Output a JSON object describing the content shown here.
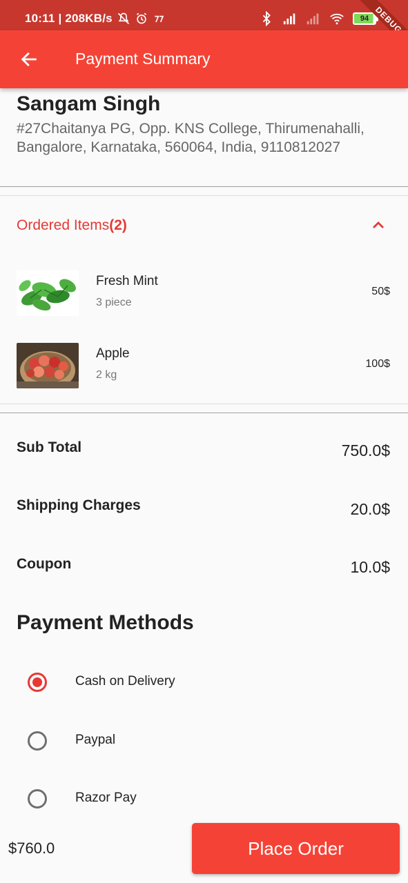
{
  "status_bar": {
    "time_speed": "10:11 | 208KB/s",
    "battery": "94",
    "debug_banner": "DEBUG"
  },
  "app_bar": {
    "title": "Payment Summary"
  },
  "address": {
    "name": "Sangam Singh",
    "text": "#27Chaitanya PG, Opp. KNS College, Thirumenahalli, Bangalore, Karnataka, 560064, India, 9110812027"
  },
  "ordered_items": {
    "label": "Ordered Items",
    "count": "(2)",
    "items": [
      {
        "name": "Fresh Mint",
        "qty": "3 piece",
        "price": "50$"
      },
      {
        "name": "Apple",
        "qty": "2 kg",
        "price": "100$"
      }
    ]
  },
  "totals": {
    "subtotal_label": "Sub Total",
    "subtotal_value": "750.0$",
    "shipping_label": "Shipping Charges",
    "shipping_value": "20.0$",
    "coupon_label": "Coupon",
    "coupon_value": "10.0$"
  },
  "payment_methods": {
    "title": "Payment Methods",
    "options": [
      {
        "label": "Cash on Delivery",
        "selected": true
      },
      {
        "label": "Paypal",
        "selected": false
      },
      {
        "label": "Razor Pay",
        "selected": false
      }
    ]
  },
  "footer": {
    "total": "$760.0",
    "place_order_label": "Place Order"
  },
  "colors": {
    "primary": "#f44336",
    "status_bar": "#c8372e",
    "accent_text": "#e53935"
  },
  "icons": {
    "back": "arrow-left-icon",
    "collapse": "chevron-up-icon"
  }
}
